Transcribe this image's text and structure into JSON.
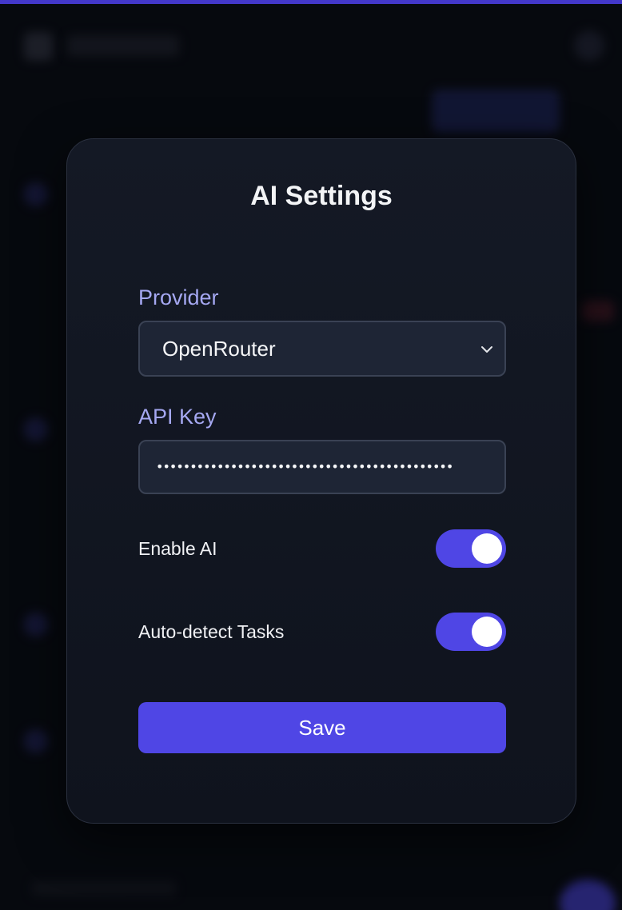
{
  "modal": {
    "title": "AI Settings",
    "provider": {
      "label": "Provider",
      "selected": "OpenRouter"
    },
    "api_key": {
      "label": "API Key",
      "value": "••••••••••••••••••••••••••••••••••••••••••••"
    },
    "toggles": [
      {
        "label": "Enable AI",
        "on": true
      },
      {
        "label": "Auto-detect Tasks",
        "on": true
      }
    ],
    "save_label": "Save"
  },
  "colors": {
    "accent": "#4f46e5",
    "label": "#a5a8f2",
    "modal_bg": "#141925",
    "field_bg": "#1e2535"
  },
  "icons": [
    "chevron-down-icon"
  ]
}
